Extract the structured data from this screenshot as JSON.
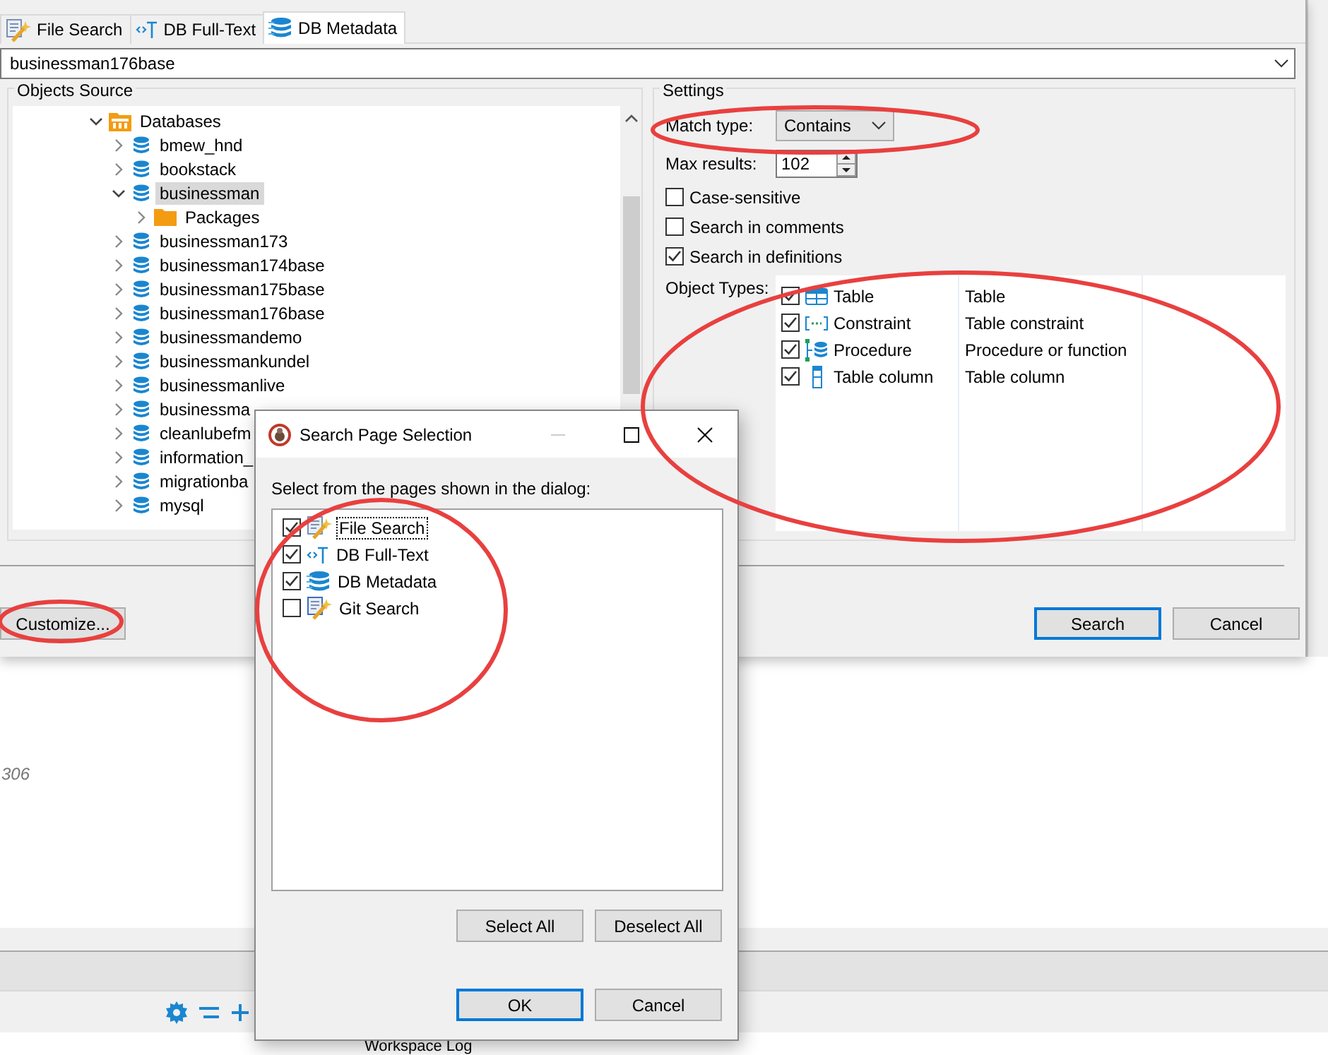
{
  "tabs": [
    {
      "label": "File Search",
      "kind": "file",
      "selected": false
    },
    {
      "label": "DB Full-Text",
      "kind": "fulltext",
      "selected": false
    },
    {
      "label": "DB Metadata",
      "kind": "metadata",
      "selected": true
    }
  ],
  "query": {
    "value": "businessman176base"
  },
  "objects_source": {
    "title": "Objects Source",
    "tree": [
      {
        "label": "Databases",
        "kind": "databases",
        "expanded": true,
        "selected": false,
        "children": [
          {
            "label": "bmew_hnd",
            "kind": "database",
            "expanded": false,
            "selected": false
          },
          {
            "label": "bookstack",
            "kind": "database",
            "expanded": false,
            "selected": false
          },
          {
            "label": "businessman",
            "kind": "database",
            "expanded": true,
            "selected": true,
            "children": [
              {
                "label": "Packages",
                "kind": "folder",
                "expanded": false,
                "selected": false
              }
            ]
          },
          {
            "label": "businessman173",
            "kind": "database",
            "expanded": false,
            "selected": false
          },
          {
            "label": "businessman174base",
            "kind": "database",
            "expanded": false,
            "selected": false
          },
          {
            "label": "businessman175base",
            "kind": "database",
            "expanded": false,
            "selected": false
          },
          {
            "label": "businessman176base",
            "kind": "database",
            "expanded": false,
            "selected": false
          },
          {
            "label": "businessmandemo",
            "kind": "database",
            "expanded": false,
            "selected": false
          },
          {
            "label": "businessmankundel",
            "kind": "database",
            "expanded": false,
            "selected": false
          },
          {
            "label": "businessmanlive",
            "kind": "database",
            "expanded": false,
            "selected": false
          },
          {
            "label": "businessma",
            "kind": "database",
            "expanded": false,
            "selected": false
          },
          {
            "label": "cleanlubefm",
            "kind": "database",
            "expanded": false,
            "selected": false
          },
          {
            "label": "information_",
            "kind": "database",
            "expanded": false,
            "selected": false
          },
          {
            "label": "migrationba",
            "kind": "database",
            "expanded": false,
            "selected": false
          },
          {
            "label": "mysql",
            "kind": "database",
            "expanded": false,
            "selected": false
          }
        ]
      }
    ]
  },
  "settings": {
    "title": "Settings",
    "match_type": {
      "label": "Match type:",
      "value": "Contains"
    },
    "max_results": {
      "label": "Max results:",
      "value": "102"
    },
    "options": [
      {
        "label": "Case-sensitive",
        "checked": false
      },
      {
        "label": "Search in comments",
        "checked": false
      },
      {
        "label": "Search in definitions",
        "checked": true
      }
    ],
    "object_types": {
      "label": "Object Types:",
      "rows": [
        {
          "name": "Table",
          "description": "Table",
          "kind": "table",
          "checked": true
        },
        {
          "name": "Constraint",
          "description": "Table constraint",
          "kind": "constraint",
          "checked": true
        },
        {
          "name": "Procedure",
          "description": "Procedure or function",
          "kind": "procedure",
          "checked": true
        },
        {
          "name": "Table column",
          "description": "Table column",
          "kind": "column",
          "checked": true
        }
      ]
    }
  },
  "buttons": {
    "customize": "Customize...",
    "search": "Search",
    "cancel": "Cancel"
  },
  "background": {
    "port_text": "306",
    "log_tab": "Workspace Log"
  },
  "dialog": {
    "title": "Search Page Selection",
    "prompt": "Select from the pages shown in the dialog:",
    "pages": [
      {
        "label": "File Search",
        "kind": "file",
        "checked": true,
        "focused": true
      },
      {
        "label": "DB Full-Text",
        "kind": "fulltext",
        "checked": true,
        "focused": false
      },
      {
        "label": "DB Metadata",
        "kind": "metadata",
        "checked": true,
        "focused": false
      },
      {
        "label": "Git Search",
        "kind": "git",
        "checked": false,
        "focused": false
      }
    ],
    "select_all": "Select All",
    "deselect_all": "Deselect All",
    "ok": "OK",
    "cancel": "Cancel"
  }
}
